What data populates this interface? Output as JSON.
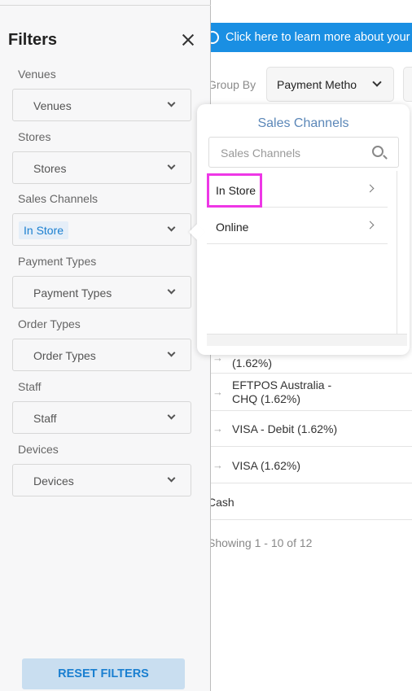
{
  "report": {
    "banner_text": "Click here to learn more about your p",
    "group_by_label": "Group By",
    "group_by_value": "Payment Metho",
    "rows": [
      {
        "text": "(1.62%)"
      },
      {
        "text": "EFTPOS Australia - CHQ (1.62%)"
      },
      {
        "text": "VISA - Debit (1.62%)"
      },
      {
        "text": "VISA (1.62%)"
      },
      {
        "text": "Cash"
      }
    ],
    "showing": "Showing 1 - 10 of 12"
  },
  "filters": {
    "title": "Filters",
    "groups": [
      {
        "label": "Venues",
        "value": "Venues"
      },
      {
        "label": "Stores",
        "value": "Stores"
      },
      {
        "label": "Sales Channels",
        "value": "In Store"
      },
      {
        "label": "Payment Types",
        "value": "Payment Types"
      },
      {
        "label": "Order Types",
        "value": "Order Types"
      },
      {
        "label": "Staff",
        "value": "Staff"
      },
      {
        "label": "Devices",
        "value": "Devices"
      }
    ],
    "reset_label": "RESET FILTERS"
  },
  "popover": {
    "title": "Sales Channels",
    "search_placeholder": "Sales Channels",
    "items": [
      {
        "label": "In Store"
      },
      {
        "label": "Online"
      }
    ]
  },
  "colors": {
    "accent": "#1a8fe3",
    "highlight": "#ee37e6",
    "popover_title": "#5b87b8"
  }
}
